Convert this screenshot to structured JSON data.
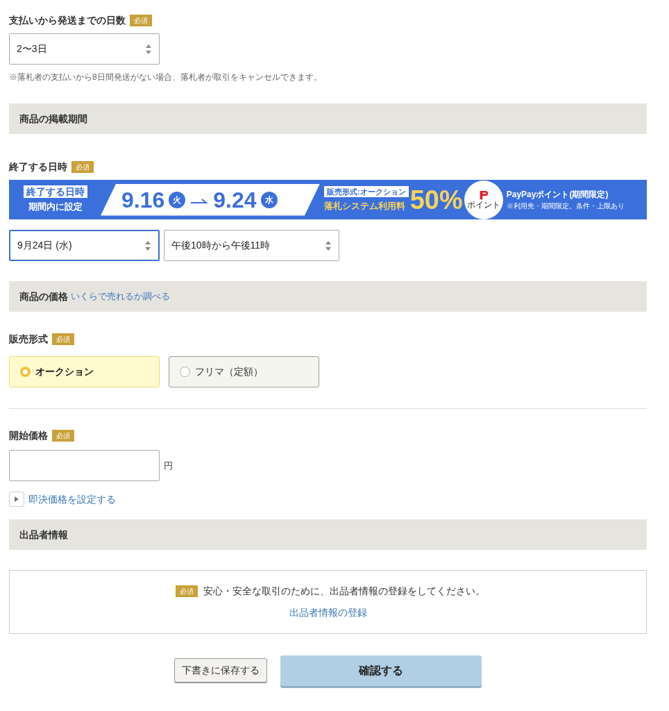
{
  "shipping_days": {
    "label": "支払いから発送までの日数",
    "badge": "必須",
    "select": {
      "value": "2〜3日",
      "focused": false
    },
    "note": "※落札者の支払いから8日間発送がない場合、落札者が取引をキャンセルできます。"
  },
  "listing_period": {
    "header": "商品の掲載期間",
    "label": "終了する日時",
    "badge": "必須",
    "banner": {
      "tag": "終了する日時",
      "subtitle": "期間内に設定",
      "start": "9.16",
      "start_day": "火",
      "end": "9.24",
      "end_day": "水",
      "format_tag": "販売形式:オークション",
      "fee_label": "落札システム利用料",
      "percent": "50%",
      "logo_text": "ポイント",
      "points": "PayPayポイント(期間限定)",
      "terms": "※利用先・期間限定。条件・上限あり"
    },
    "selects": [
      {
        "value": "9月24日 (水)",
        "focused": true
      },
      {
        "value": "午後10時から午後11時",
        "focused": false
      }
    ]
  },
  "price": {
    "header": "商品の価格",
    "header_link": "いくらで売れるか調べる",
    "format_label": "販売形式",
    "format_badge": "必須",
    "formats": [
      {
        "label": "オークション",
        "selected": true
      },
      {
        "label": "フリマ（定額）",
        "selected": false
      }
    ],
    "start_label": "開始価格",
    "start_badge": "必須",
    "unit": "円",
    "buy_now_toggle": {
      "label": "即決価格を設定する",
      "expanded": false
    }
  },
  "seller": {
    "header": "出品者情報",
    "badge": "必須",
    "message": "安心・安全な取引のために、出品者情報の登録をしてください。",
    "link": "出品者情報の登録"
  },
  "buttons": {
    "draft": "下書きに保存する",
    "confirm": "確認する"
  }
}
